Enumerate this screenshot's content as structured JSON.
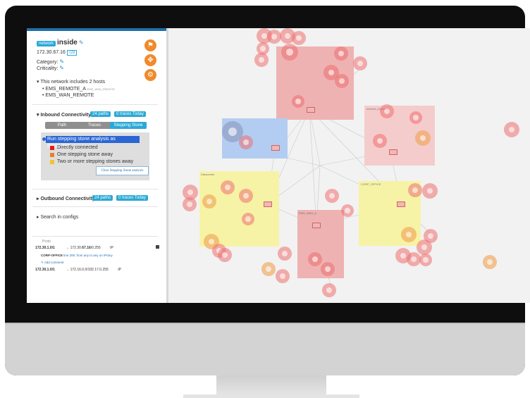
{
  "panel": {
    "network_tag": "network",
    "name": "inside",
    "ip": "172.30.67.16",
    "prefix": "/28",
    "category_label": "Category:",
    "criticality_label": "Criticality:",
    "hosts_text": "This network includes 2 hosts",
    "hosts": [
      {
        "name": "EMS_REMOTE_A",
        "note": "EMS_WAN_REMOTE"
      },
      {
        "name": "EMS_WAN_REMOTE",
        "note": ""
      }
    ],
    "inbound": {
      "title": "Inbound Connectivity",
      "paths_badge": "24 paths",
      "traces_badge": "0 traces Today",
      "tabs": [
        "Path",
        "Traces",
        "Stepping Stone"
      ],
      "run_label": "Run stepping stone analysis as destination",
      "legend": [
        {
          "label": "Directly connected",
          "color": "#e31b1b"
        },
        {
          "label": "One stepping stone away",
          "color": "#f07e22"
        },
        {
          "label": "Two or more stepping stones away",
          "color": "#f5c12e"
        }
      ],
      "clear_button": "Clear Stepping Stone analysis"
    },
    "outbound": {
      "title": "Outbound Connectivity",
      "paths_badge": "24 paths",
      "traces_badge": "0 traces Today"
    },
    "search_label": "Search in configs",
    "rules": {
      "header": "Proto",
      "row1_src": "172.30.1.0/1",
      "row1_arrow": "→",
      "row1_dst_prefix": "172.30.",
      "row1_dst_bold": "67.16",
      "row1_dst_suffix": "/0.255",
      "row1_proto": "IP",
      "comment_bold": "CORP-OFFICE",
      "comment_rest": "line 205: from any to any on IP/any",
      "add_comment": "Add comment",
      "row2_src": "172.30.1.0/1",
      "row2_arrow": "→",
      "row2_dst": "172.16.0.0/192.17.0.255",
      "row2_proto": "IP"
    }
  },
  "graph": {
    "zone_labels": [
      "Internet_Gateway",
      "Datacenter",
      "CORP_OFFICE",
      "EMS_WAN_A"
    ]
  },
  "colors": {
    "accent_blue": "#2aa9d6",
    "panel_topbar": "#1f6fa8",
    "zone_red": "#efb0b0",
    "zone_yellow": "#f7f3a6",
    "zone_blue": "#b2cdf1"
  }
}
